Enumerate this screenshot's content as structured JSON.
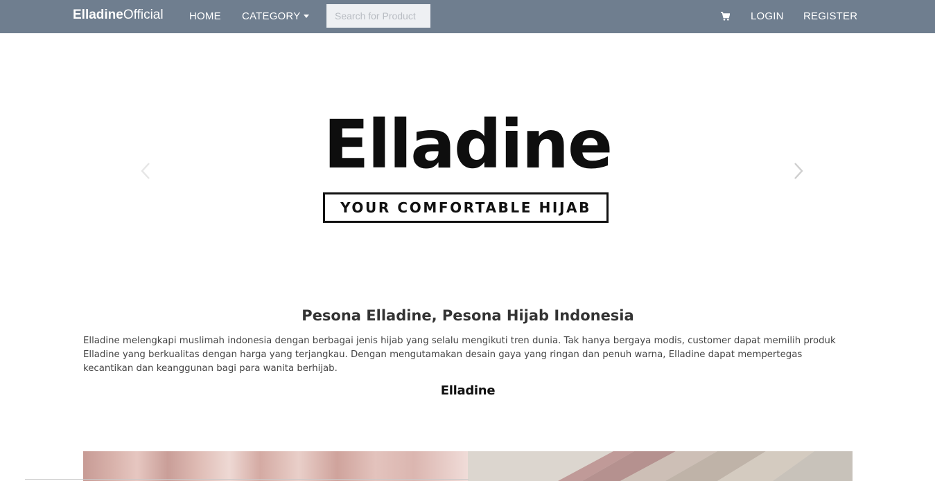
{
  "navbar": {
    "brand_bold": "Elladine",
    "brand_rest": "Official",
    "home_label": "HOME",
    "category_label": "CATEGORY",
    "search_placeholder": "Search for Product",
    "cart_icon": "shopping-cart-icon",
    "login_label": "LOGIN",
    "register_label": "REGISTER",
    "background_color": "#6f7e8f"
  },
  "carousel": {
    "logo_word": "Elladine",
    "logo_tagline": "YOUR COMFORTABLE HIJAB",
    "prev_icon": "chevron-left-icon",
    "next_icon": "chevron-right-icon"
  },
  "about": {
    "title": "Pesona Elladine, Pesona Hijab Indonesia",
    "text": "Elladine melengkapi muslimah indonesia dengan berbagai jenis hijab yang selalu mengikuti tren dunia. Tak hanya bergaya modis, customer dapat memilih produk Elladine yang berkualitas dengan harga yang terjangkau. Dengan mengutamakan desain gaya yang ringan dan penuh warna, Elladine dapat mempertegas kecantikan dan keanggunan bagi para wanita berhijab.",
    "signature": "Elladine"
  }
}
